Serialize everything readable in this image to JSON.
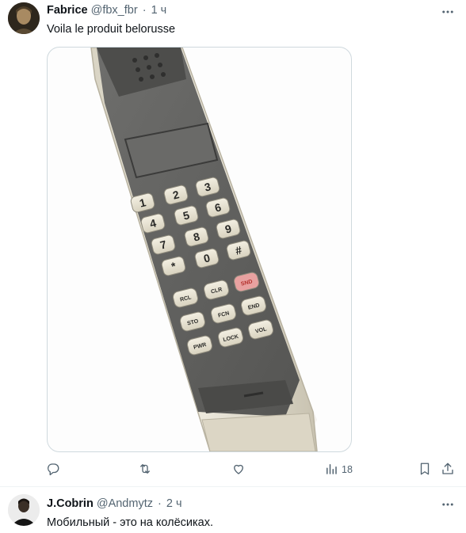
{
  "tweets": [
    {
      "name": "Fabrice",
      "handle": "@fbx_fbr",
      "separator": "·",
      "time": "1 ч",
      "text": "Voila le produit belorusse",
      "actions": {
        "views": "18"
      }
    },
    {
      "name": "J.Cobrin",
      "handle": "@Andmytz",
      "separator": "·",
      "time": "2 ч",
      "text": "Мобильный - это на колёсиках."
    }
  ],
  "phone_keys": {
    "row1": [
      "1",
      "2",
      "3"
    ],
    "row2": [
      "4",
      "5",
      "6"
    ],
    "row3": [
      "7",
      "8",
      "9"
    ],
    "row4": [
      "*",
      "0",
      "#"
    ],
    "row5": [
      "RCL",
      "CLR",
      "SND"
    ],
    "row6": [
      "STO",
      "FCN",
      "END"
    ],
    "row7": [
      "PWR",
      "LOCK",
      "VOL"
    ]
  },
  "colors": {
    "text": "#0f1419",
    "secondary": "#536471",
    "border": "#cfd9de",
    "send_key": "#e8a1a0"
  },
  "icons": [
    "more-icon",
    "reply-icon",
    "retweet-icon",
    "like-icon",
    "views-icon",
    "bookmark-icon",
    "share-icon"
  ]
}
